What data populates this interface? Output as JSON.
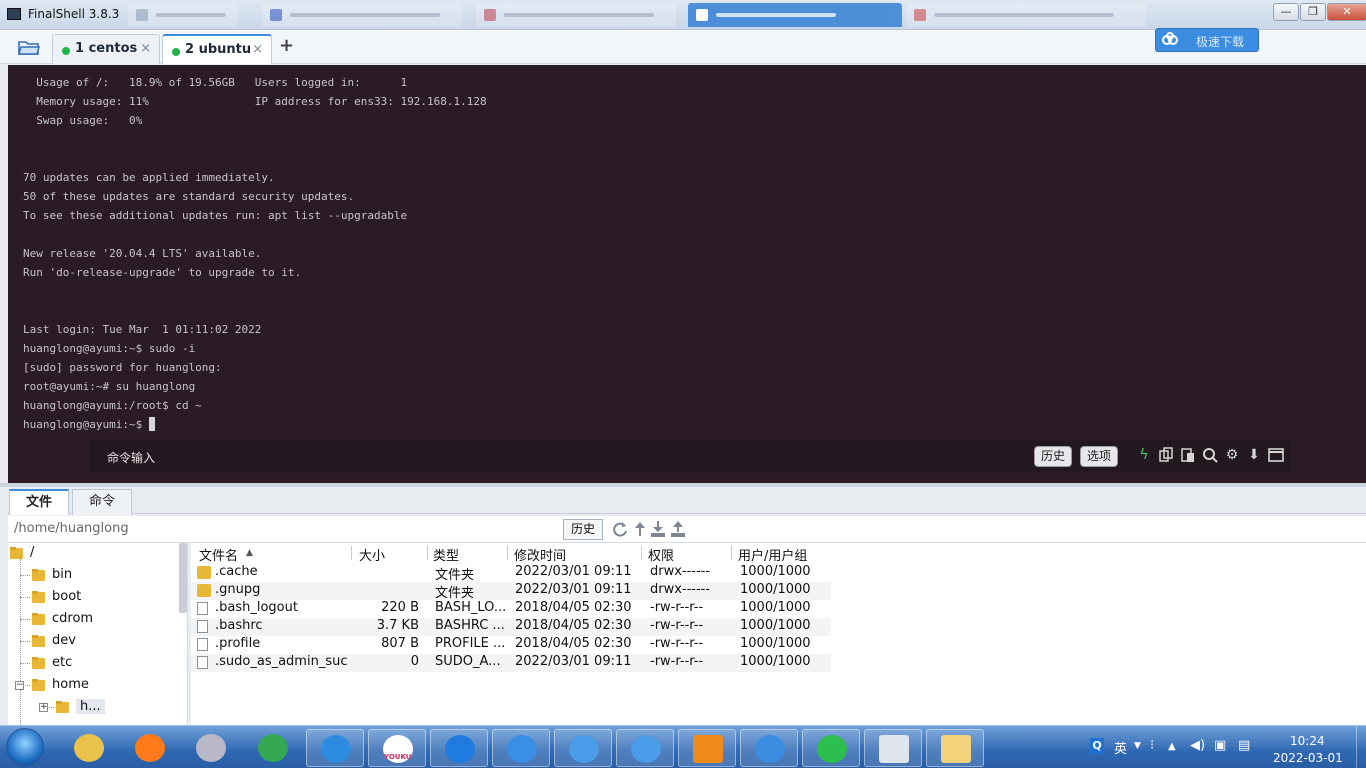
{
  "window": {
    "title": "FinalShell 3.8.3",
    "controls": [
      "—",
      "❐",
      "✕"
    ]
  },
  "session_tabs": [
    {
      "label": "1 centos",
      "close": "×",
      "active": false
    },
    {
      "label": "2 ubuntu",
      "close": "×",
      "active": true
    }
  ],
  "toolbar": {
    "add_tab": "+",
    "speed_button": "极速下载",
    "colors": {
      "accent": "#3a8de0",
      "connected": "#21b24b"
    }
  },
  "terminal": {
    "lines": [
      "  Usage of /:   18.9% of 19.56GB   Users logged in:      1",
      "  Memory usage: 11%                IP address for ens33: 192.168.1.128",
      "  Swap usage:   0%",
      "",
      "",
      "70 updates can be applied immediately.",
      "50 of these updates are standard security updates.",
      "To see these additional updates run: apt list --upgradable",
      "",
      "New release '20.04.4 LTS' available.",
      "Run 'do-release-upgrade' to upgrade to it.",
      "",
      "",
      "Last login: Tue Mar  1 01:11:02 2022",
      "huanglong@ayumi:~$ sudo -i",
      "[sudo] password for huanglong:",
      "root@ayumi:~# su huanglong",
      "huanglong@ayumi:/root$ cd ~",
      "huanglong@ayumi:~$ "
    ],
    "background": "#2a1b25"
  },
  "command_bar": {
    "input_label": "命令输入",
    "history_button": "历史",
    "options_button": "选项",
    "icons": [
      "lightning-icon",
      "copy-icon",
      "paste-icon",
      "search-icon",
      "gear-icon",
      "download-arrow-icon",
      "maximize-icon"
    ]
  },
  "bottom_tabs": [
    {
      "label": "文件",
      "active": true
    },
    {
      "label": "命令",
      "active": false
    }
  ],
  "pathbar": {
    "path": "/home/huanglong",
    "history_button": "历史",
    "icons": [
      "refresh-icon",
      "up-dir-icon",
      "download-icon",
      "upload-icon"
    ]
  },
  "tree": {
    "root": "/",
    "items": [
      {
        "label": "bin"
      },
      {
        "label": "boot"
      },
      {
        "label": "cdrom"
      },
      {
        "label": "dev"
      },
      {
        "label": "etc"
      },
      {
        "label": "home"
      },
      {
        "label": "h..."
      }
    ],
    "expander_minus": "−",
    "expander_plus": "+"
  },
  "filelist": {
    "columns": [
      "文件名",
      "大小",
      "类型",
      "修改时间",
      "权限",
      "用户/用户组"
    ],
    "sort_indicator": "▲",
    "rows": [
      {
        "name": ".cache",
        "size": "",
        "type": "文件夹",
        "modified": "2022/03/01 09:11",
        "perm": "drwx------",
        "owner": "1000/1000",
        "kind": "folder"
      },
      {
        "name": ".gnupg",
        "size": "",
        "type": "文件夹",
        "modified": "2022/03/01 09:11",
        "perm": "drwx------",
        "owner": "1000/1000",
        "kind": "folder"
      },
      {
        "name": ".bash_logout",
        "size": "220 B",
        "type": "BASH_LO...",
        "modified": "2018/04/05 02:30",
        "perm": "-rw-r--r--",
        "owner": "1000/1000",
        "kind": "file"
      },
      {
        "name": ".bashrc",
        "size": "3.7 KB",
        "type": "BASHRC ...",
        "modified": "2018/04/05 02:30",
        "perm": "-rw-r--r--",
        "owner": "1000/1000",
        "kind": "file"
      },
      {
        "name": ".profile",
        "size": "807 B",
        "type": "PROFILE ...",
        "modified": "2018/04/05 02:30",
        "perm": "-rw-r--r--",
        "owner": "1000/1000",
        "kind": "file"
      },
      {
        "name": ".sudo_as_admin_suc...",
        "size": "0",
        "type": "SUDO_A...",
        "modified": "2022/03/01 09:11",
        "perm": "-rw-r--r--",
        "owner": "1000/1000",
        "kind": "file"
      }
    ]
  },
  "taskbar": {
    "apps": [
      "paint-icon",
      "firefox-icon",
      "media-player-icon",
      "chrome-icon",
      "qq-browser-icon",
      "youku-icon",
      "pp-icon",
      "feishu-icon",
      "chat-icon",
      "chat-icon-2",
      "vmware-icon",
      "finalshell-cloud-icon",
      "wechat-icon",
      "remote-desktop-icon",
      "explorer-icon"
    ],
    "youku_label": "YOUKU",
    "ime": "Q",
    "ime_lang": "英",
    "clock_time": "10:24",
    "clock_date": "2022-03-01"
  }
}
